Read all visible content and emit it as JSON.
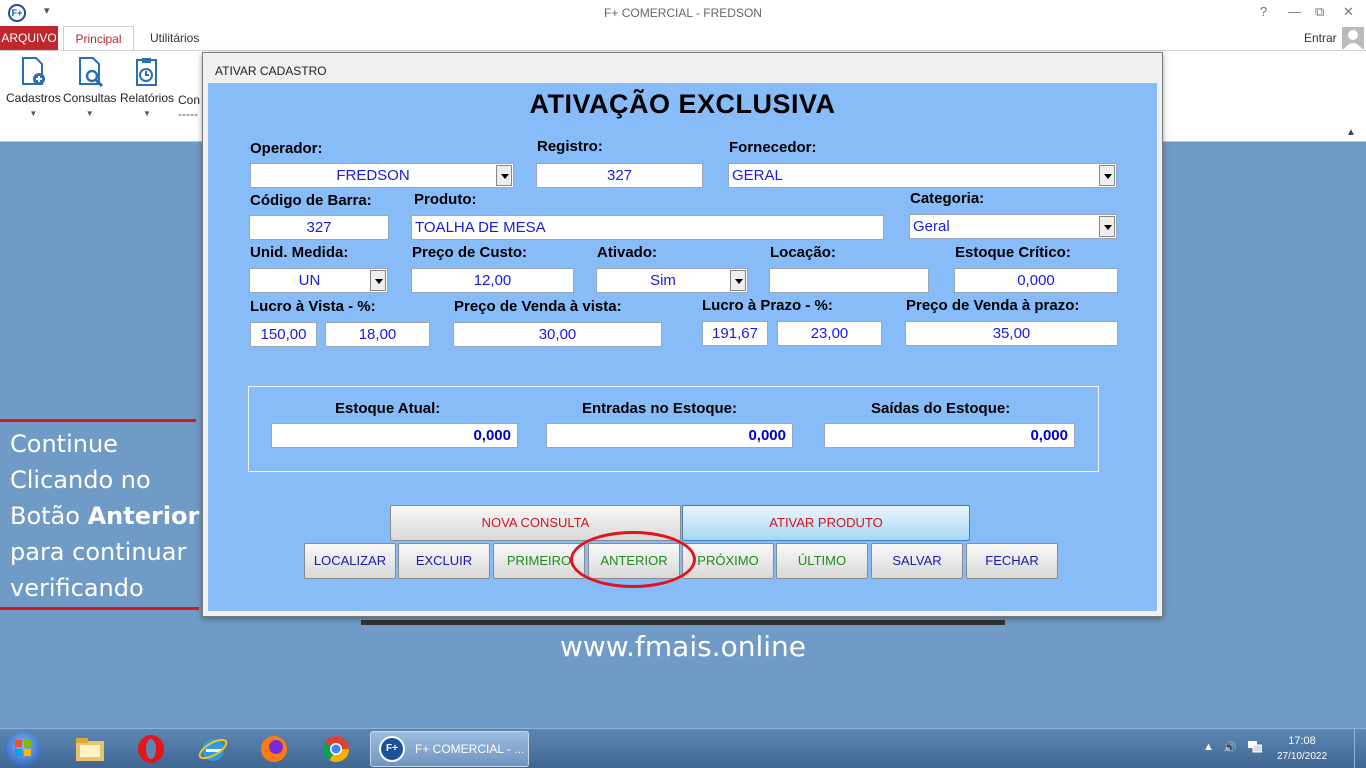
{
  "window": {
    "title": "F+ COMERCIAL - FREDSON",
    "app_icon": "F+",
    "help": "?",
    "minimize": "—",
    "restore": "⧉",
    "close": "✕"
  },
  "ribbon": {
    "tabs": {
      "arquivo": "ARQUIVO",
      "principal": "Principal",
      "utilitarios": "Utilitários"
    },
    "entrar": "Entrar",
    "buttons": {
      "cadastros": "Cadastros",
      "consultas": "Consultas",
      "relatorios": "Relatórios",
      "partial": "Con",
      "partial_sub": "-----"
    }
  },
  "dialog": {
    "title": "ATIVAR CADASTRO",
    "heading": "ATIVAÇÃO EXCLUSIVA",
    "labels": {
      "operador": "Operador:",
      "registro": "Registro:",
      "fornecedor": "Fornecedor:",
      "codigo_barra": "Código de Barra:",
      "produto": "Produto:",
      "categoria": "Categoria:",
      "unid_medida": "Unid. Medida:",
      "preco_custo": "Preço de Custo:",
      "ativado": "Ativado:",
      "locacao": "Locação:",
      "estoque_critico": "Estoque Crítico:",
      "lucro_vista": "Lucro à Vista - %:",
      "preco_venda_vista": "Preço de Venda à vista:",
      "lucro_prazo": "Lucro à Prazo - %:",
      "preco_venda_prazo": "Preço de Venda à prazo:",
      "estoque_atual": "Estoque Atual:",
      "entradas_estoque": "Entradas no Estoque:",
      "saidas_estoque": "Saídas do Estoque:"
    },
    "values": {
      "operador": "FREDSON",
      "registro": "327",
      "fornecedor": "GERAL",
      "codigo_barra": "327",
      "produto": "TOALHA DE MESA",
      "categoria": "Geral",
      "unid_medida": "UN",
      "preco_custo": "12,00",
      "ativado": "Sim",
      "locacao": "",
      "estoque_critico": "0,000",
      "lucro_vista_pct": "150,00",
      "lucro_vista_val": "18,00",
      "preco_venda_vista": "30,00",
      "lucro_prazo_pct": "191,67",
      "lucro_prazo_val": "23,00",
      "preco_venda_prazo": "35,00",
      "estoque_atual": "0,000",
      "entradas_estoque": "0,000",
      "saidas_estoque": "0,000"
    },
    "buttons": {
      "nova_consulta": "NOVA CONSULTA",
      "ativar_produto": "ATIVAR PRODUTO",
      "localizar": "LOCALIZAR",
      "excluir": "EXCLUIR",
      "primeiro": "PRIMEIRO",
      "anterior": "ANTERIOR",
      "proximo": "PRÓXIMO",
      "ultimo": "ÚLTIMO",
      "salvar": "SALVAR",
      "fechar": "FECHAR"
    }
  },
  "overlay": {
    "note_lines": [
      "Continue",
      "Clicando no"
    ],
    "note_prefix": "Botão ",
    "note_bold": "Anterior",
    "note_end": [
      "para continuar",
      "verificando"
    ],
    "website": "www.fmais.online",
    "highlight_color": "#e0141a"
  },
  "taskbar": {
    "task_label": "F+ COMERCIAL - ...",
    "task_icon": "F+",
    "time": "17:08",
    "date": "27/10/2022",
    "icons": [
      "windows-start-icon",
      "file-explorer-icon",
      "opera-icon",
      "internet-explorer-icon",
      "firefox-icon",
      "chrome-icon"
    ]
  }
}
